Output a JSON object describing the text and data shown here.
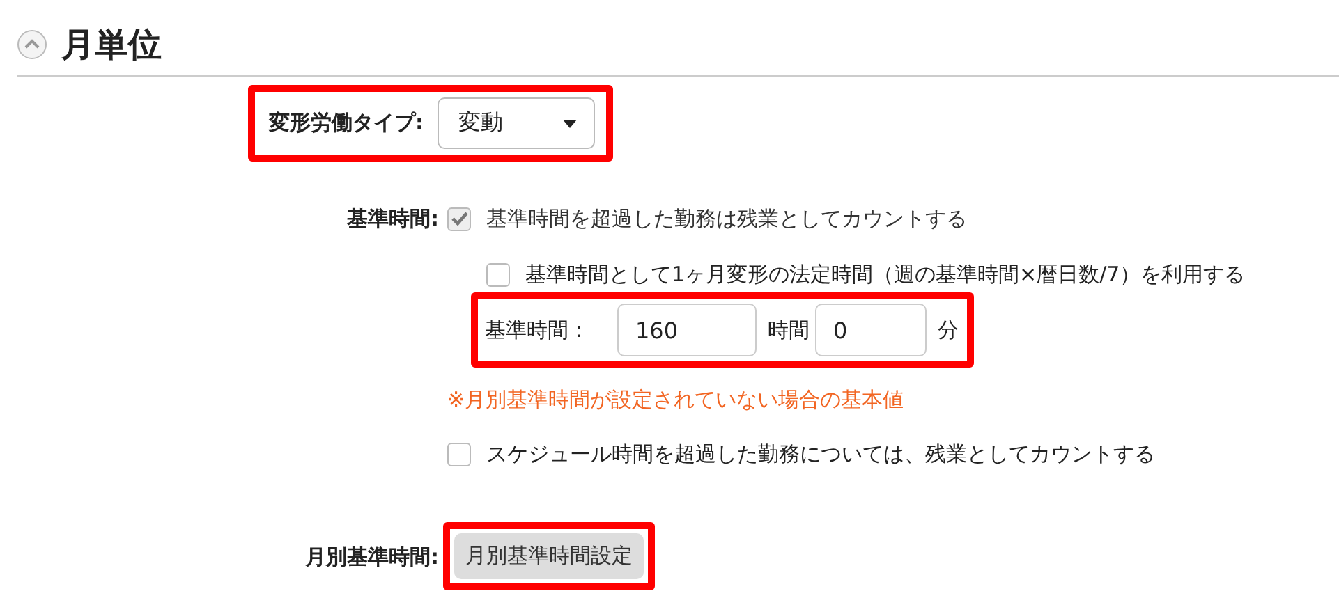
{
  "section": {
    "title": "月単位",
    "expanded": true
  },
  "work_type": {
    "label": "変形労働タイプ:",
    "value": "変動",
    "highlighted": true
  },
  "base_time": {
    "label": "基準時間:",
    "options": [
      {
        "label": "基準時間を超過した勤務は残業としてカウントする",
        "checked": true,
        "disabled": true
      },
      {
        "label": "基準時間として1ヶ月変形の法定時間（週の基準時間×暦日数/7）を利用する",
        "checked": false,
        "disabled": false
      }
    ],
    "hours": {
      "label": "基準時間：",
      "hours_value": "160",
      "hours_unit": "時間",
      "minutes_value": "0",
      "minutes_unit": "分",
      "highlighted": true
    },
    "note": "※月別基準時間が設定されていない場合の基本値",
    "schedule_option": {
      "label": "スケジュール時間を超過した勤務については、残業としてカウントする",
      "checked": false,
      "disabled": false
    }
  },
  "monthly": {
    "label": "月別基準時間:",
    "button": "月別基準時間設定",
    "highlighted": true
  }
}
